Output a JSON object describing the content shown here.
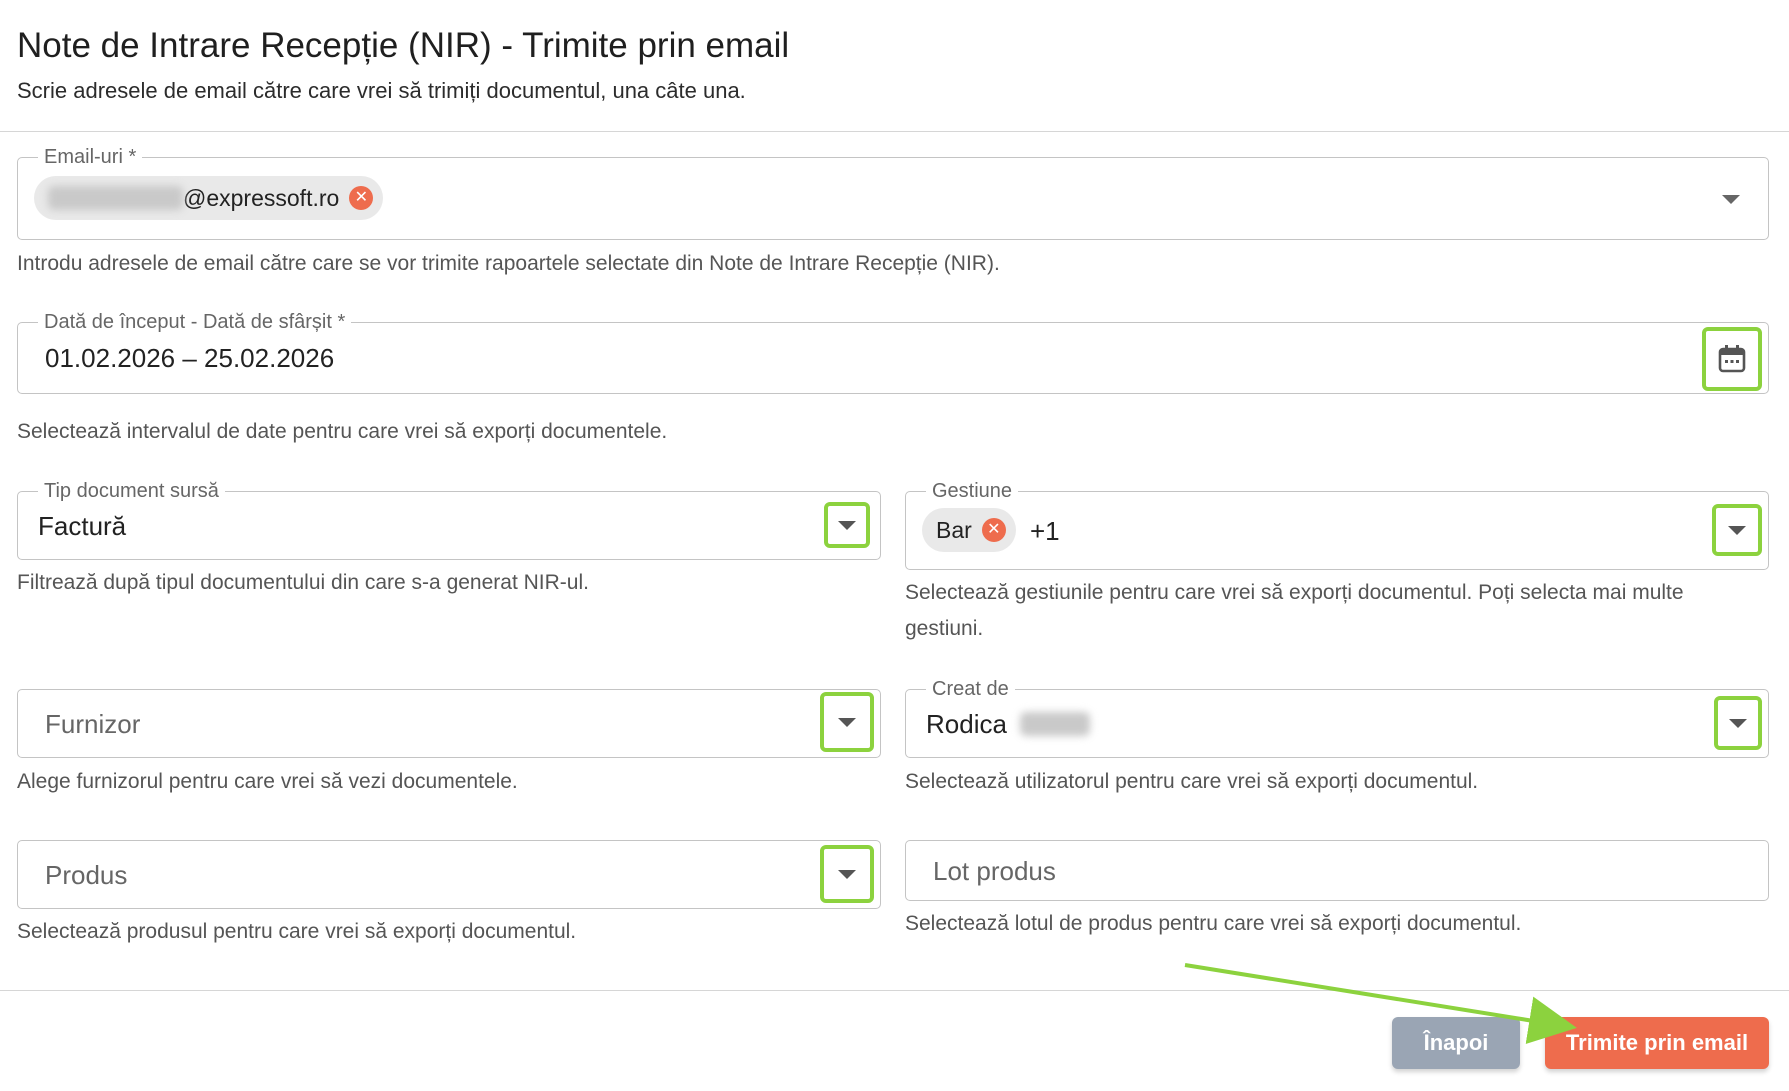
{
  "header": {
    "title": "Note de Intrare Recepție (NIR) - Trimite prin email",
    "subtitle": "Scrie adresele de email către care vrei să trimiți documentul, una câte una."
  },
  "emails": {
    "label": "Email-uri *",
    "chip_domain": "@expressoft.ro",
    "helper": "Introdu adresele de email către care se vor trimite rapoartele selectate din Note de Intrare Recepție (NIR)."
  },
  "date_range": {
    "label": "Dată de început - Dată de sfârșit *",
    "value": "01.02.2026 – 25.02.2026",
    "helper": "Selectează intervalul de date pentru care vrei să exporți documentele."
  },
  "source_type": {
    "label": "Tip document sursă",
    "value": "Factură",
    "helper": "Filtrează după tipul documentului din care s-a generat NIR-ul."
  },
  "gestiune": {
    "label": "Gestiune",
    "chip": "Bar",
    "more": "+1",
    "helper": "Selectează gestiunile pentru care vrei să exporți documentul. Poți selecta mai multe gestiuni."
  },
  "supplier": {
    "placeholder": "Furnizor",
    "helper": "Alege furnizorul pentru care vrei să vezi documentele."
  },
  "created_by": {
    "label": "Creat de",
    "value": "Rodica",
    "helper": "Selectează utilizatorul pentru care vrei să exporți documentul."
  },
  "product": {
    "placeholder": "Produs",
    "helper": "Selectează produsul pentru care vrei să exporți documentul."
  },
  "lot": {
    "placeholder": "Lot produs",
    "helper": "Selectează lotul de produs pentru care vrei să exporți documentul."
  },
  "actions": {
    "back": "Înapoi",
    "send": "Trimite prin email"
  },
  "colors": {
    "accent": "#ee6c4d",
    "highlight": "#8cd23e",
    "back_button": "#9aa5b4"
  },
  "icons": {
    "calendar": "calendar-icon",
    "remove": "close-circle-icon",
    "dropdown": "chevron-down-icon",
    "annotation": "arrow-annotation"
  }
}
